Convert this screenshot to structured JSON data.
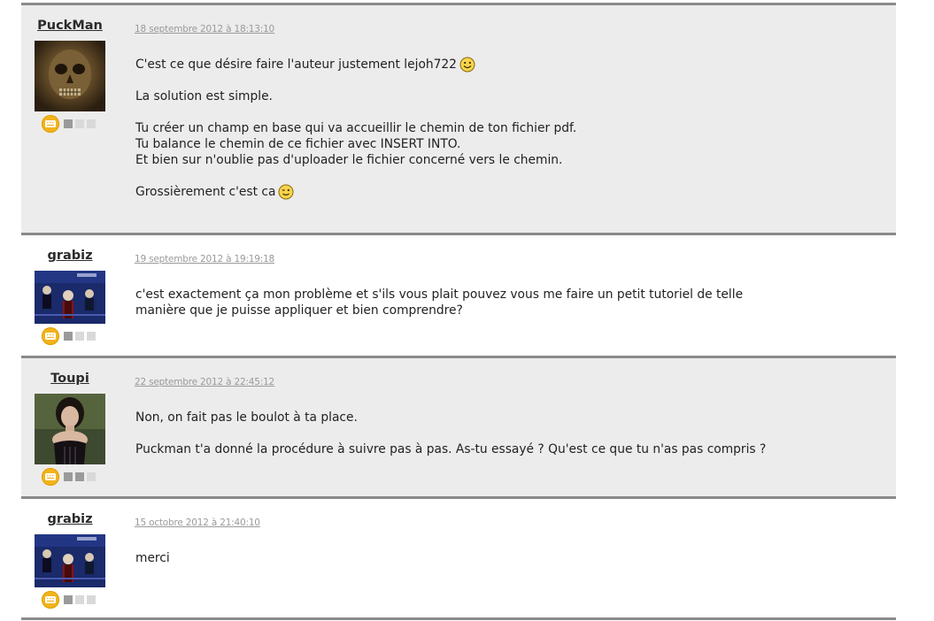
{
  "posts": [
    {
      "author": "PuckMan",
      "date": "18 septembre 2012 à 18:13:10",
      "rank_on": 1,
      "paragraphs": [
        "C'est ce que désire faire l'auteur justement lejoh722",
        "La solution est simple.",
        "Tu créer un champ en base qui va accueillir le chemin de ton fichier pdf.",
        "Tu balance le chemin de ce fichier avec INSERT INTO.",
        "Et bien sur n'oublie pas d'uploader le fichier concerné vers le chemin.",
        "Grossièrement c'est ca"
      ]
    },
    {
      "author": "grabiz",
      "date": "19 septembre 2012 à 19:19:18",
      "rank_on": 1,
      "paragraphs": [
        "c'est exactement ça mon problème et s'ils vous plait pouvez vous me faire un petit tutoriel de telle",
        "manière que je puisse appliquer et bien comprendre?"
      ]
    },
    {
      "author": "Toupi",
      "date": "22 septembre 2012 à 22:45:12",
      "rank_on": 2,
      "paragraphs": [
        "Non, on fait pas le boulot à ta place.",
        "Puckman t'a donné la procédure à suivre pas à pas. As-tu essayé ? Qu'est ce que tu n'as pas compris ?"
      ]
    },
    {
      "author": "grabiz",
      "date": "15 octobre 2012 à 21:40:10",
      "rank_on": 1,
      "paragraphs": [
        "merci"
      ]
    }
  ],
  "icons": {
    "rank_badge": "keyboard-badge-icon",
    "smile": "smiley-icon",
    "wink": "wink-smiley-icon"
  },
  "colors": {
    "shaded_bg": "#ececec",
    "separator": "#8a8a8a",
    "badge": "#f2b31b"
  }
}
